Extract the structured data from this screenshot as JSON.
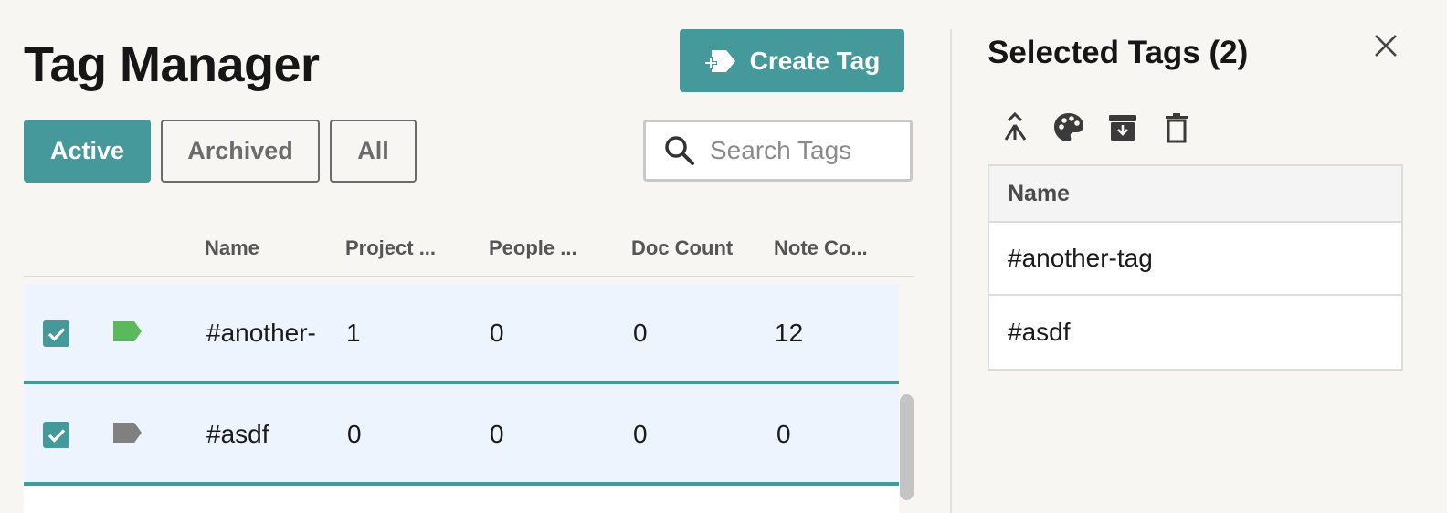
{
  "page": {
    "title": "Tag Manager"
  },
  "toolbar": {
    "create_label": "Create Tag"
  },
  "filters": [
    {
      "label": "Active",
      "selected": true
    },
    {
      "label": "Archived",
      "selected": false
    },
    {
      "label": "All",
      "selected": false
    }
  ],
  "search": {
    "placeholder": "Search Tags",
    "value": ""
  },
  "table": {
    "columns": [
      "Name",
      "Project ...",
      "People ...",
      "Doc Count",
      "Note Co..."
    ],
    "rows": [
      {
        "checked": true,
        "tag_color": "#5cb85c",
        "name": "#another-",
        "project": "1",
        "people": "0",
        "doc": "0",
        "note": "12"
      },
      {
        "checked": true,
        "tag_color": "#808080",
        "name": "#asdf",
        "project": "0",
        "people": "0",
        "doc": "0",
        "note": "0"
      }
    ]
  },
  "panel": {
    "title": "Selected Tags (2)",
    "actions": [
      "merge-icon",
      "palette-icon",
      "archive-icon",
      "delete-icon"
    ],
    "column": "Name",
    "selected": [
      "#another-tag",
      "#asdf"
    ]
  },
  "colors": {
    "accent": "#46999a",
    "row_highlight": "#edf4fe",
    "background": "#f7f6f2"
  }
}
